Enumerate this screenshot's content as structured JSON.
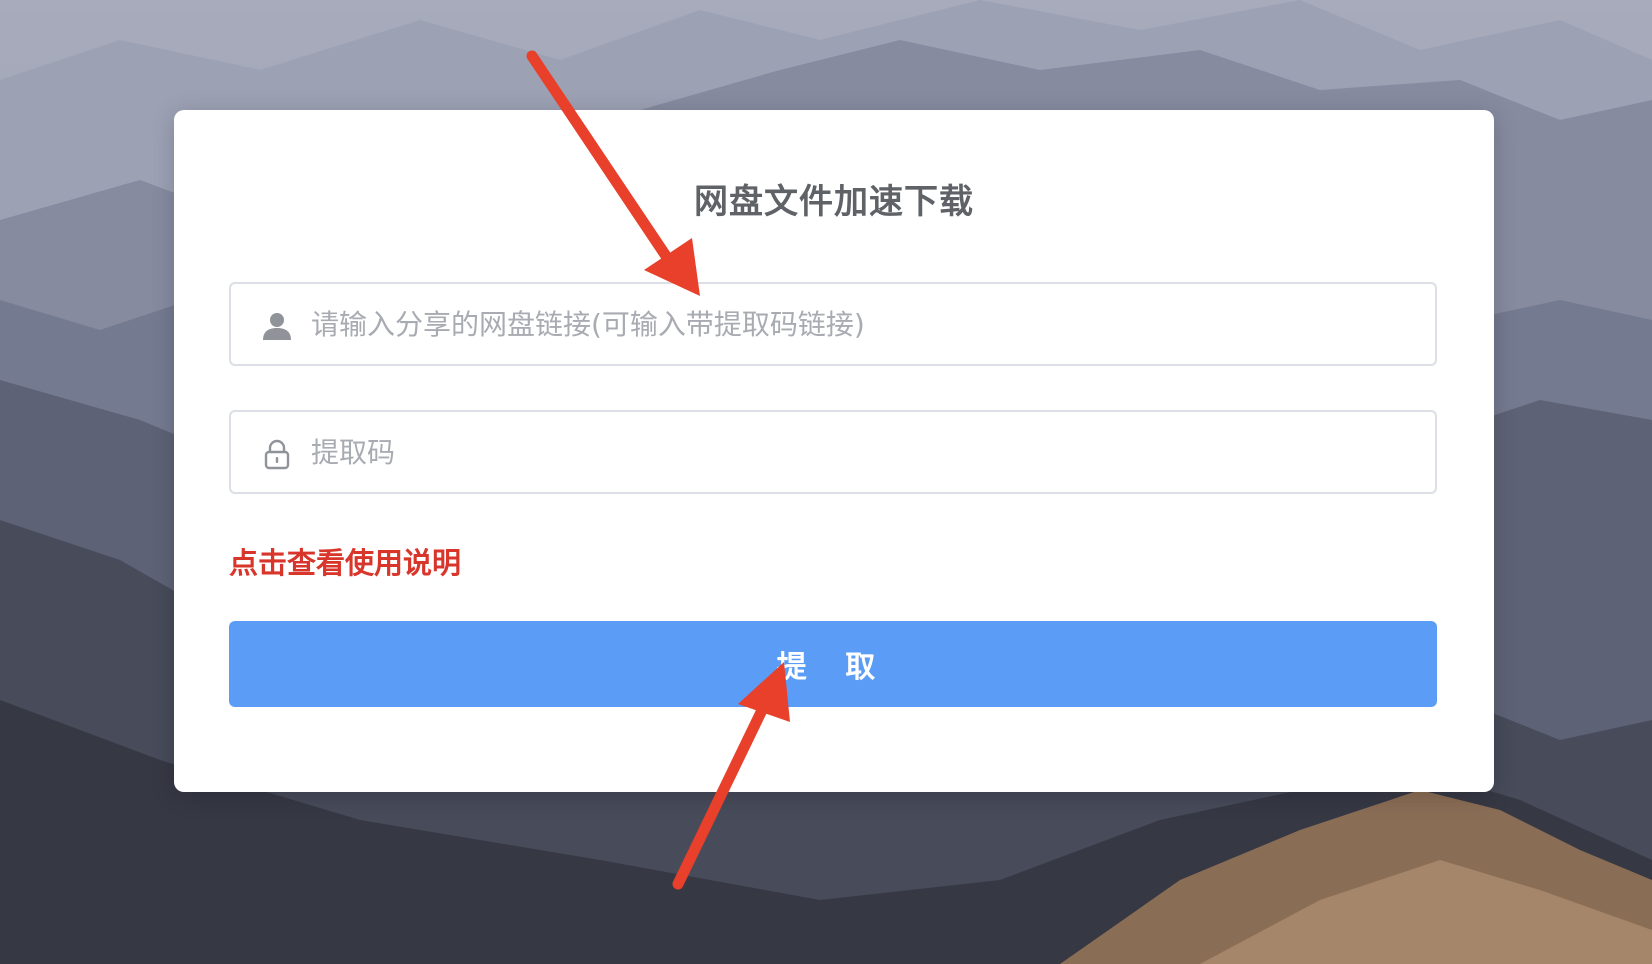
{
  "page": {
    "title": "网盘文件加速下载"
  },
  "form": {
    "link_placeholder": "请输入分享的网盘链接(可输入带提取码链接)",
    "link_value": "",
    "code_placeholder": "提取码",
    "code_value": "",
    "help_link": "点击查看使用说明",
    "submit_label": "提 取"
  },
  "icons": {
    "link_field_icon": "user-icon",
    "code_field_icon": "lock-icon"
  },
  "colors": {
    "accent": "#5b9cf6",
    "help_link": "#d9362b",
    "annotation_arrow": "#e8402a"
  }
}
